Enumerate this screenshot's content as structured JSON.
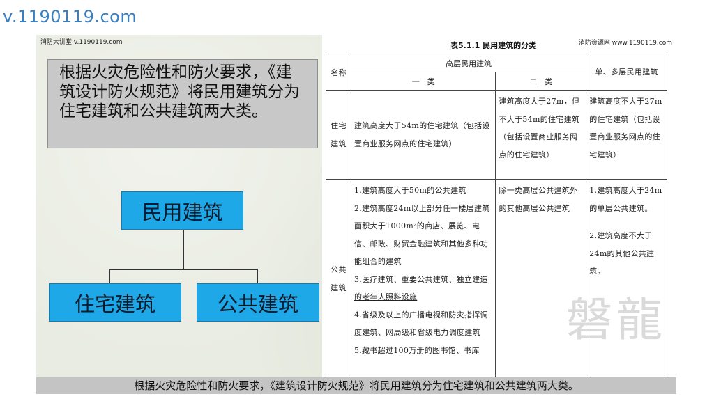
{
  "site_url": "v.1190119.com",
  "header": {
    "left_text": "消防大讲堂 v.1190119.com",
    "right_text": "消防资源网 www.1190119.com"
  },
  "intro_text": "根据火灾危险性和防火要求，《建筑设计防火规范》将民用建筑分为住宅建筑和公共建筑两大类。",
  "diagram": {
    "root": "民用建筑",
    "children": [
      "住宅建筑",
      "公共建筑"
    ]
  },
  "table": {
    "title": "表5.1.1 民用建筑的分类",
    "headers": {
      "name": "名称",
      "high_rise": "高层民用建筑",
      "class_one": "一　类",
      "class_two": "二　类",
      "low_rise": "单、多层民用建筑"
    },
    "rows": {
      "residential": {
        "name": "住宅建筑",
        "class_one": "建筑高度大于54m的住宅建筑（包括设置商业服务网点的住宅建筑）",
        "class_two": "建筑高度大于27m，但不大于54m的住宅建筑（包括设置商业服务网点的住宅建筑）",
        "low_rise": "建筑高度不大于27m的住宅建筑（包括设置商业服务网点的住宅建筑）"
      },
      "public": {
        "name": "公共建筑",
        "class_one": [
          "1.建筑高度大于50m的公共建筑",
          "2.建筑高度24m以上部分任一楼层建筑面积大于1000m²的商店、展览、电信、邮政、财贸金融建筑和其他多种功能组合的建筑",
          "3.医疗建筑、重要公共建筑、",
          "独立建造的老年人照料设施",
          "4.省级及以上的广播电视和防灾指挥调度建筑、网局级和省级电力调度建筑",
          "5.藏书超过100万册的图书馆、书库"
        ],
        "class_two": "除一类高层公共建筑外的其他高层公共建筑",
        "low_rise": [
          "1.建筑高度大于24m的单层公共建筑。",
          "2.建筑高度不大于24m的其他公共建筑。"
        ]
      }
    }
  },
  "watermark": "磐龍",
  "caption": "根据火灾危险性和防火要求，《建筑设计防火规范》将民用建筑分为住宅建筑和公共建筑两大类。"
}
